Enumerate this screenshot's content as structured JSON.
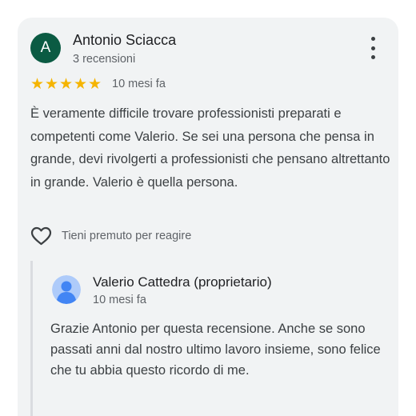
{
  "review": {
    "author_initial": "A",
    "author_name": "Antonio Sciacca",
    "author_meta": "3 recensioni",
    "rating": 5,
    "rating_max": 5,
    "stars": [
      "★",
      "★",
      "★",
      "★",
      "★"
    ],
    "date": "10 mesi fa",
    "text": "È veramente difficile trovare professionisti preparati e competenti come Valerio. Se sei una persona che pensa in grande, devi rivolgerti a professionisti che pensano altrettanto in grande. Valerio è quella persona.",
    "react_label": "Tieni premuto per reagire",
    "colors": {
      "avatar": "#0b5b43",
      "star": "#f5b400",
      "card": "#f1f3f4"
    },
    "icons": {
      "more": "more-vert-icon",
      "react": "heart-outline-icon"
    }
  },
  "reply": {
    "owner_name": "Valerio Cattedra (proprietario)",
    "date": "10 mesi fa",
    "text": "Grazie Antonio per questa recensione. Anche se sono passati anni dal nostro ultimo lavoro insieme, sono felice che tu abbia questo ricordo di me.",
    "icons": {
      "avatar": "default-profile-icon"
    },
    "colors": {
      "avatar_bg": "#aecbfa",
      "avatar_fg": "#4285f4"
    }
  }
}
